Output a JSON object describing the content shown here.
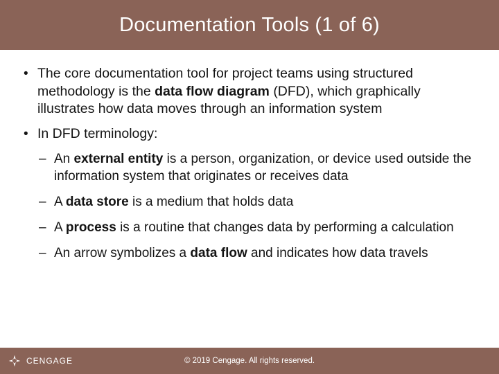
{
  "title": "Documentation Tools (1 of 6)",
  "bullets": {
    "b1_pre": "The core documentation tool for project teams using structured methodology is the ",
    "b1_bold": "data flow diagram ",
    "b1_post": "(DFD), which graphically illustrates how data moves through an information system",
    "b2": "In DFD terminology:",
    "s1_pre": "An ",
    "s1_bold": "external entity ",
    "s1_post": "is a person, organization, or device used outside the information system that originates or receives data",
    "s2_pre": "A ",
    "s2_bold": "data store ",
    "s2_post": "is a medium that holds data",
    "s3_pre": "A ",
    "s3_bold": "process ",
    "s3_post": "is a routine that changes data by performing a calculation",
    "s4_pre": "An arrow symbolizes a ",
    "s4_bold": "data flow ",
    "s4_post": "and indicates how data travels"
  },
  "footer": {
    "copyright": "© 2019 Cengage. All rights reserved.",
    "brand": "CENGAGE"
  }
}
